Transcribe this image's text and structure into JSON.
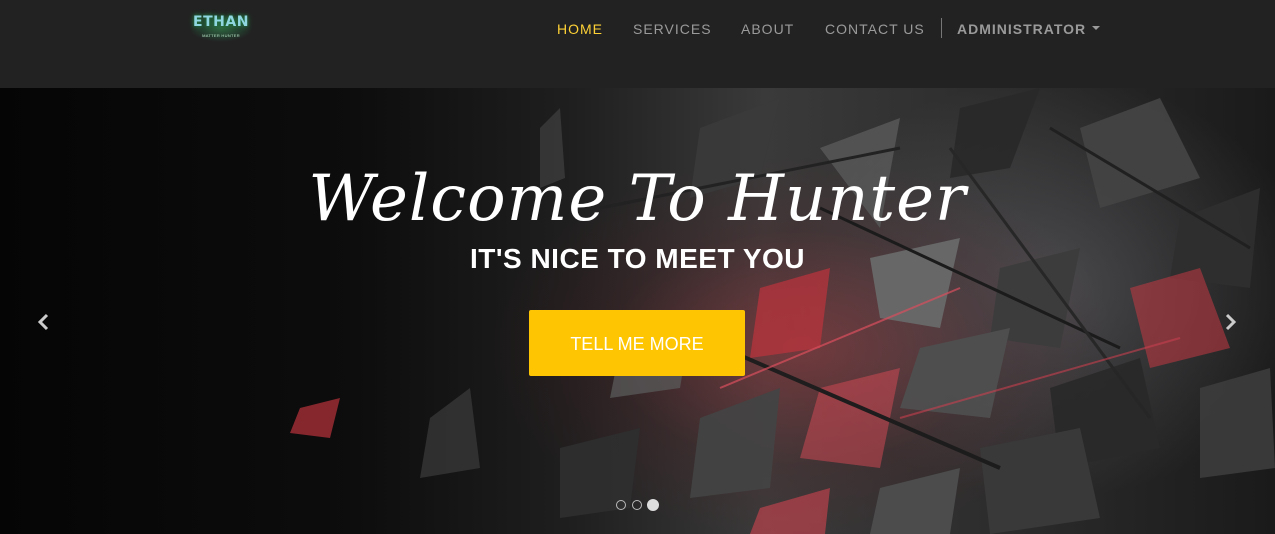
{
  "brand": {
    "logo_text": "ETHAN",
    "logo_subtext": "MATTER HUNTER"
  },
  "nav": {
    "items": [
      {
        "label": "HOME",
        "active": true
      },
      {
        "label": "SERVICES",
        "active": false
      },
      {
        "label": "ABOUT",
        "active": false
      },
      {
        "label": "CONTACT US",
        "active": false
      }
    ],
    "user_menu": "ADMINISTRATOR",
    "active_color": "#fed136",
    "text_color": "#9a9a9a"
  },
  "hero": {
    "title": "Welcome To Hunter",
    "subtitle": "IT'S NICE TO MEET YOU",
    "cta_label": "TELL ME MORE",
    "cta_color": "#fec503",
    "prev_icon": "chevron-left-icon",
    "next_icon": "chevron-right-icon",
    "slide_count": 3,
    "active_slide": 3
  }
}
